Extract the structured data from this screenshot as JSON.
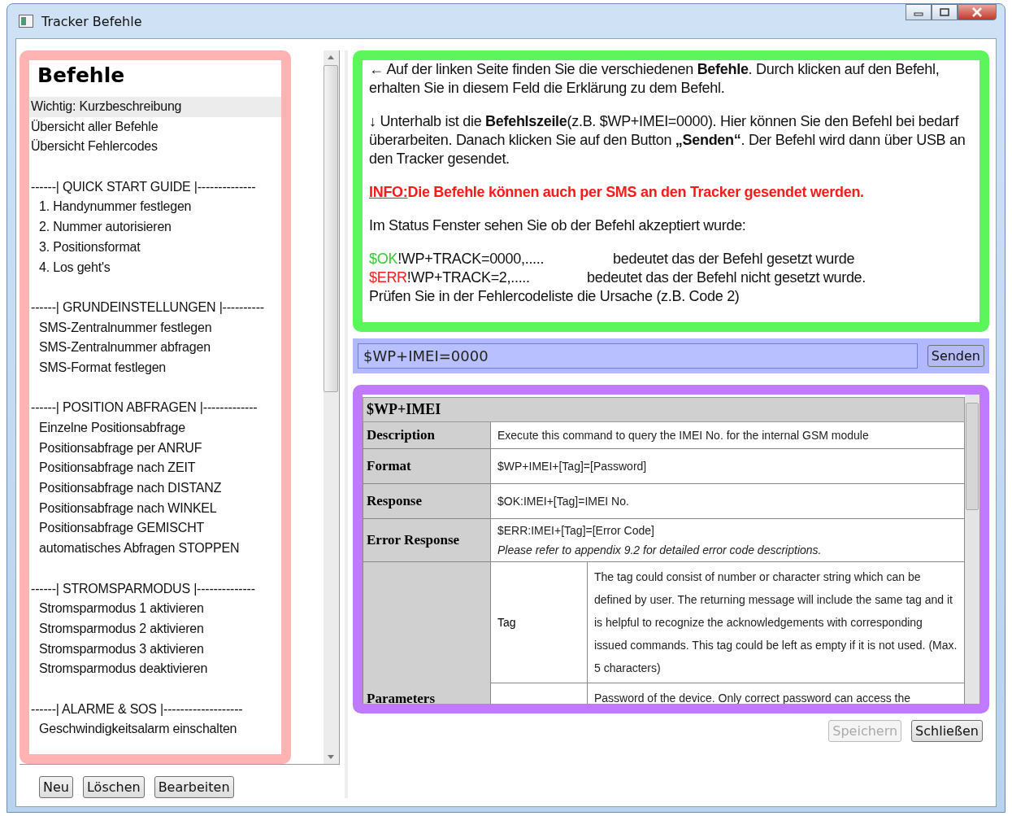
{
  "window": {
    "title": "Tracker Befehle"
  },
  "commands": {
    "heading": "Befehle",
    "items": [
      {
        "kind": "item",
        "label": "Wichtig: Kurzbeschreibung",
        "selected": true
      },
      {
        "kind": "item",
        "label": "Übersicht aller Befehle",
        "selected": false
      },
      {
        "kind": "item",
        "label": "Übersicht Fehlercodes",
        "selected": false
      },
      {
        "kind": "section",
        "label": "------| QUICK START GUIDE |--------------",
        "selected": false
      },
      {
        "kind": "sub",
        "label": "1. Handynummer festlegen",
        "selected": false
      },
      {
        "kind": "sub",
        "label": "2. Nummer autorisieren",
        "selected": false
      },
      {
        "kind": "sub",
        "label": "3. Positionsformat",
        "selected": false
      },
      {
        "kind": "sub",
        "label": "4. Los geht's",
        "selected": false
      },
      {
        "kind": "section",
        "label": "------| GRUNDEINSTELLUNGEN |----------",
        "selected": false
      },
      {
        "kind": "sub",
        "label": "SMS-Zentralnummer festlegen",
        "selected": false
      },
      {
        "kind": "sub",
        "label": "SMS-Zentralnummer abfragen",
        "selected": false
      },
      {
        "kind": "sub",
        "label": "SMS-Format festlegen",
        "selected": false
      },
      {
        "kind": "section",
        "label": "------| POSITION ABFRAGEN |-------------",
        "selected": false
      },
      {
        "kind": "sub",
        "label": "Einzelne Positionsabfrage",
        "selected": false
      },
      {
        "kind": "sub",
        "label": "Positionsabfrage per ANRUF",
        "selected": false
      },
      {
        "kind": "sub",
        "label": "Positionsabfrage nach ZEIT",
        "selected": false
      },
      {
        "kind": "sub",
        "label": "Positionsabfrage nach DISTANZ",
        "selected": false
      },
      {
        "kind": "sub",
        "label": "Positionsabfrage nach WINKEL",
        "selected": false
      },
      {
        "kind": "sub",
        "label": "Positionsabfrage GEMISCHT",
        "selected": false
      },
      {
        "kind": "sub",
        "label": "automatisches Abfragen STOPPEN",
        "selected": false
      },
      {
        "kind": "section",
        "label": "------| STROMSPARMODUS |--------------",
        "selected": false
      },
      {
        "kind": "sub",
        "label": "Stromsparmodus 1 aktivieren",
        "selected": false
      },
      {
        "kind": "sub",
        "label": "Stromsparmodus 2 aktivieren",
        "selected": false
      },
      {
        "kind": "sub",
        "label": "Stromsparmodus 3 aktivieren",
        "selected": false
      },
      {
        "kind": "sub",
        "label": "Stromsparmodus deaktivieren",
        "selected": false
      },
      {
        "kind": "section",
        "label": "------| ALARME & SOS |-------------------",
        "selected": false
      },
      {
        "kind": "sub",
        "label": "Geschwindigkeitsalarm einschalten",
        "selected": false
      }
    ],
    "buttons": [
      "Neu",
      "Löschen",
      "Bearbeiten"
    ]
  },
  "help": {
    "paragraphs": [
      {
        "kind": "text",
        "text": "← Auf der linken Seite finden Sie die verschiedenen **Befehle**. Durch klicken auf den Befehl, erhalten Sie in diesem Feld die Erklärung zu dem Befehl."
      },
      {
        "kind": "text",
        "text": "↓  Unterhalb ist die **Befehlszeile**(z.B. $WP+IMEI=0000). Hier können Sie den Befehl bei bedarf überarbeiten. Danach klicken Sie auf den Button **„Senden“**. Der Befehl wird dann über USB an den Tracker gesendet."
      },
      {
        "kind": "info",
        "label": "INFO:",
        "text": "Die Befehle können auch per SMS an den Tracker gesendet werden."
      },
      {
        "kind": "text",
        "text": "Im Status Fenster sehen Sie ob der Befehl akzeptiert wurde:"
      },
      {
        "kind": "status",
        "lines": [
          {
            "code": "$OK",
            "color": "#33cc33",
            "command": "!WP+TRACK=0000,.....",
            "meaning": "bedeutet das der Befehl gesetzt wurde"
          },
          {
            "code": "$ERR",
            "color": "#ff2020",
            "command": "!WP+TRACK=2,.....",
            "meaning": "bedeutet das der Befehl nicht gesetzt wurde."
          }
        ],
        "note": "Prüfen Sie in der Fehlercodeliste die Ursache (z.B. Code 2)"
      }
    ]
  },
  "command_line": {
    "value": "$WP+IMEI=0000",
    "button": "Senden"
  },
  "detail": {
    "title": "$WP+IMEI",
    "rows": [
      {
        "label": "Description",
        "values": [
          "Execute this command to query the IMEI No. for the internal GSM module"
        ]
      },
      {
        "label": "Format",
        "values": [
          "$WP+IMEI+[Tag]=[Password]"
        ]
      },
      {
        "label": "Response",
        "values": [
          "$OK:IMEI+[Tag]=IMEI No."
        ]
      },
      {
        "label": "Error Response",
        "values": [
          "$ERR:IMEI+[Tag]=[Error Code]",
          "*Please refer to appendix 9.2 for detailed error code descriptions.*"
        ]
      }
    ],
    "parameters": {
      "label": "Parameters",
      "items": [
        {
          "name": "Tag",
          "text": "The tag could consist of number or character string which can be defined by user. The returning message will include the same tag and it is helpful to recognize the acknowledgements with corresponding issued commands. This tag could be left as empty if it is not used. (Max. 5 characters)"
        },
        {
          "text": "Password of the device. Only correct password can access the"
        }
      ]
    }
  },
  "footer": {
    "buttons": [
      {
        "label": "Speichern",
        "disabled": true
      },
      {
        "label": "Schließen",
        "disabled": false
      }
    ]
  }
}
